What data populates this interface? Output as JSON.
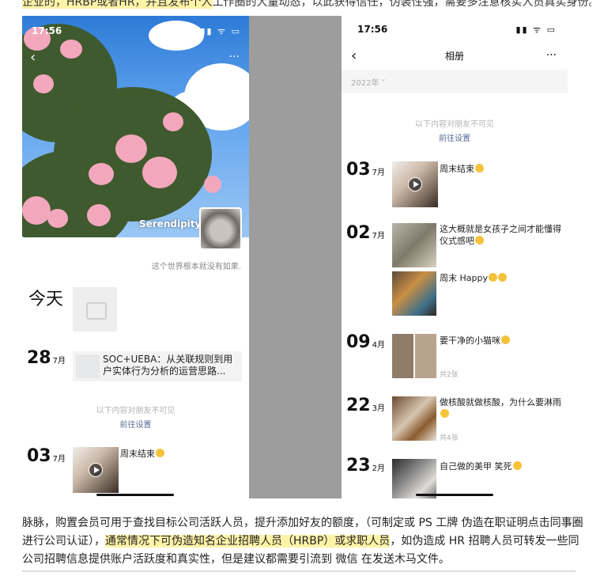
{
  "top_snippet": {
    "highlight": "企业的，HRBP或者HR，并且发布个人",
    "rest": "工作圈的大量动态，以此获得信任，伪装性强，需要多注意核实人员真实身份。"
  },
  "left_phone": {
    "status_time": "17:56",
    "status_icons": "▮▮ ᯤ ▭",
    "back_icon": "‹",
    "more_icon": "···",
    "username": "Serendipity",
    "signature": "这个世界根本就没有如果.",
    "today_label": "今天",
    "entry1": {
      "day": "28",
      "month": "7月",
      "article_title": "SOC+UEBA：从关联规则到用户实体行为分析的运营思路..."
    },
    "visibility_hint": "以下内容对朋友不可见",
    "settings_link": "前往设置",
    "entry2": {
      "day": "03",
      "month": "7月",
      "text": "周末结束"
    }
  },
  "right_phone": {
    "status_time": "17:56",
    "status_icons": "▮▮ ᯤ ▭",
    "back_icon": "‹",
    "title": "相册",
    "more_icon": "···",
    "year_filter": "2022年 ˅",
    "visibility_hint": "以下内容对朋友不可见",
    "settings_link": "前往设置",
    "posts": [
      {
        "day": "03",
        "month": "7月",
        "text": "周末结束"
      },
      {
        "day": "02",
        "month": "7月",
        "text": "这大概就是女孩子之间才能懂得仪式感吧",
        "text2": "周末 Happy"
      },
      {
        "day": "09",
        "month": "4月",
        "text": "要干净的小猫咪",
        "count": "共2张"
      },
      {
        "day": "22",
        "month": "3月",
        "text": "做核酸就做核酸，为什么要淋雨",
        "count": "共4张"
      },
      {
        "day": "23",
        "month": "2月",
        "text": "自己做的美甲 笑死"
      }
    ]
  },
  "article": {
    "part1": "脉脉，购置会员可用于查找目标公司活跃人员，提升添加好友的额度，（可制定或 PS 工牌 伪造在职证明点击同事圈进行公司认证），",
    "highlight": "通常情况下可伪造知名企业招聘人员（HRBP）或求职人员",
    "part2": "，如伪造成 HR 招聘人员可转发一些同公司招聘信息提供账户活跃度和真实性，但是建议都需要引流到 微信 在发送木马文件。"
  }
}
